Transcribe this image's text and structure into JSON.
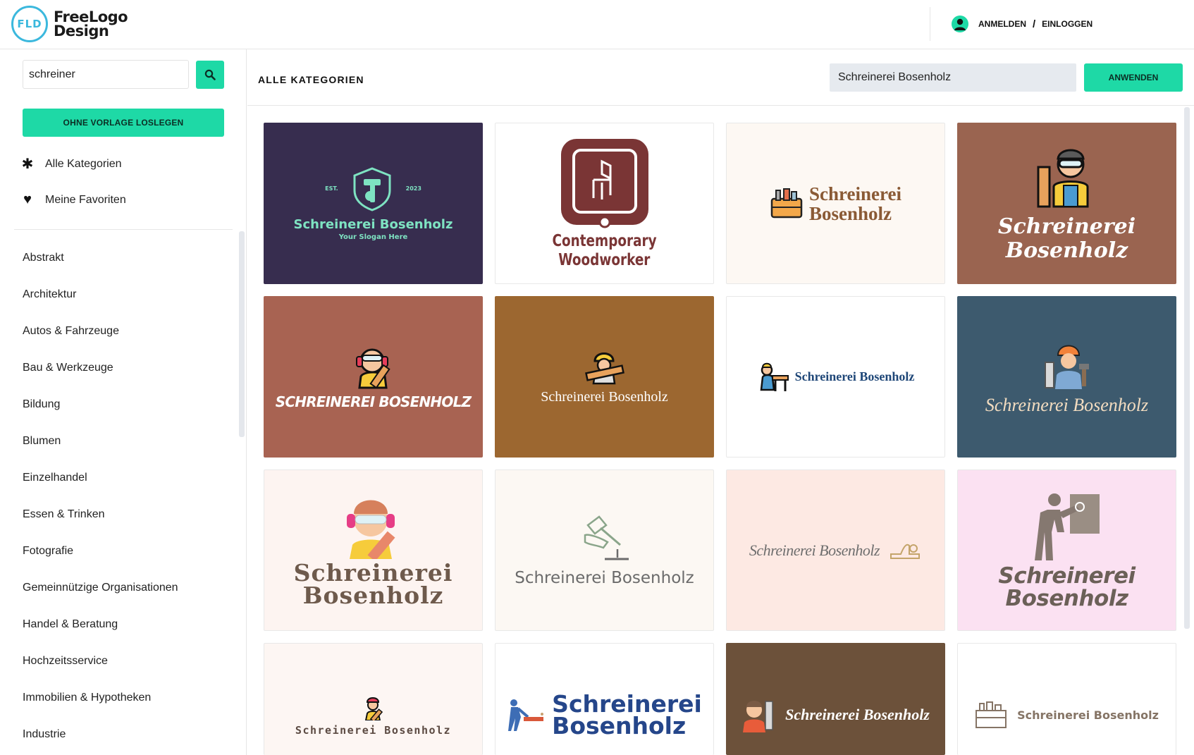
{
  "header": {
    "logo_mark": "FLD",
    "logo_line1": "FreeLogo",
    "logo_line2": "Design",
    "login_label": "ANMELDEN",
    "separator": "/",
    "signin_label": "EINLOGGEN"
  },
  "sidebar": {
    "search_value": "schreiner",
    "blank_button": "OHNE VORLAGE LOSLEGEN",
    "all_categories": "Alle Kategorien",
    "favorites": "Meine Favoriten",
    "categories": [
      "Abstrakt",
      "Architektur",
      "Autos & Fahrzeuge",
      "Bau & Werkzeuge",
      "Bildung",
      "Blumen",
      "Einzelhandel",
      "Essen & Trinken",
      "Fotografie",
      "Gemeinnützige Organisationen",
      "Handel & Beratung",
      "Hochzeitsservice",
      "Immobilien & Hypotheken",
      "Industrie"
    ]
  },
  "topbar": {
    "title": "ALLE KATEGORIEN",
    "name_value": "Schreinerei Bosenholz",
    "apply_button": "ANWENDEN"
  },
  "logos": [
    {
      "line1": "Schreinerei Bosenholz",
      "slogan": "Your Slogan Here",
      "est": "EST.",
      "year": "2023",
      "bg": "#372d4f",
      "color": "#7ee3c2"
    },
    {
      "line1": "Contemporary",
      "line2": "Woodworker",
      "bg": "#ffffff",
      "color": "#7a3535"
    },
    {
      "line1": "Schreinerei",
      "line2": "Bosenholz",
      "bg": "#fdf8f3",
      "color": "#8a5a35"
    },
    {
      "line1": "Schreinerei",
      "line2": "Bosenholz",
      "bg": "#9a6450",
      "color": "#ffffff"
    },
    {
      "line1": "SCHREINEREI BOSENHOLZ",
      "bg": "#a86352",
      "color": "#ffffff"
    },
    {
      "line1": "Schreinerei Bosenholz",
      "bg": "#9c6730",
      "color": "#ffffff"
    },
    {
      "line1": "Schreinerei Bosenholz",
      "bg": "#ffffff",
      "color": "#1f4778"
    },
    {
      "line1": "Schreinerei Bosenholz",
      "bg": "#3d5a6e",
      "color": "#f2dcc0"
    },
    {
      "line1": "Schreinerei",
      "line2": "Bosenholz",
      "bg": "#fdf4f1",
      "color": "#6e5a4c"
    },
    {
      "line1": "Schreinerei Bosenholz",
      "bg": "#fcf8f3",
      "color": "#6b6b6b"
    },
    {
      "line1": "Schreinerei Bosenholz",
      "bg": "#fde9e3",
      "color": "#6e6e6e"
    },
    {
      "line1": "Schreinerei",
      "line2": "Bosenholz",
      "bg": "#fbe1f2",
      "color": "#6b6058"
    },
    {
      "line1": "Schreinerei Bosenholz",
      "bg": "#fdf6f3",
      "color": "#5b4a42"
    },
    {
      "line1": "Schreinerei",
      "line2": "Bosenholz",
      "bg": "#ffffff",
      "color": "#25468a"
    },
    {
      "line1": "Schreinerei Bosenholz",
      "bg": "#6c513a",
      "color": "#ffffff"
    },
    {
      "line1": "Schreinerei Bosenholz",
      "bg": "#ffffff",
      "color": "#857465"
    }
  ],
  "colors": {
    "accent": "#1ed9a6",
    "logo_ring": "#3bb8dd"
  }
}
